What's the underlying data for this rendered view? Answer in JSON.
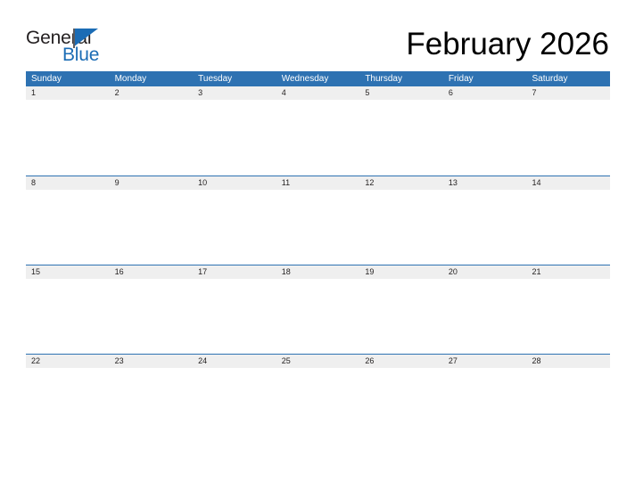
{
  "brand": {
    "name_part_1": "General",
    "name_part_2": "Blue",
    "flag_icon": "blue-triangle-flag",
    "color_dark": "#231f20",
    "color_blue": "#1b6cb5"
  },
  "header": {
    "title": "February 2026",
    "month": "February",
    "year": "2026"
  },
  "theme": {
    "header_blue": "#2e72b2",
    "date_band_gray": "#efefef",
    "text_dark": "#221f1f",
    "page_background": "#ffffff"
  },
  "calendar": {
    "weekdays": [
      "Sunday",
      "Monday",
      "Tuesday",
      "Wednesday",
      "Thursday",
      "Friday",
      "Saturday"
    ],
    "weeks": [
      {
        "dates": [
          "1",
          "2",
          "3",
          "4",
          "5",
          "6",
          "7"
        ]
      },
      {
        "dates": [
          "8",
          "9",
          "10",
          "11",
          "12",
          "13",
          "14"
        ]
      },
      {
        "dates": [
          "15",
          "16",
          "17",
          "18",
          "19",
          "20",
          "21"
        ]
      },
      {
        "dates": [
          "22",
          "23",
          "24",
          "25",
          "26",
          "27",
          "28"
        ]
      }
    ]
  }
}
